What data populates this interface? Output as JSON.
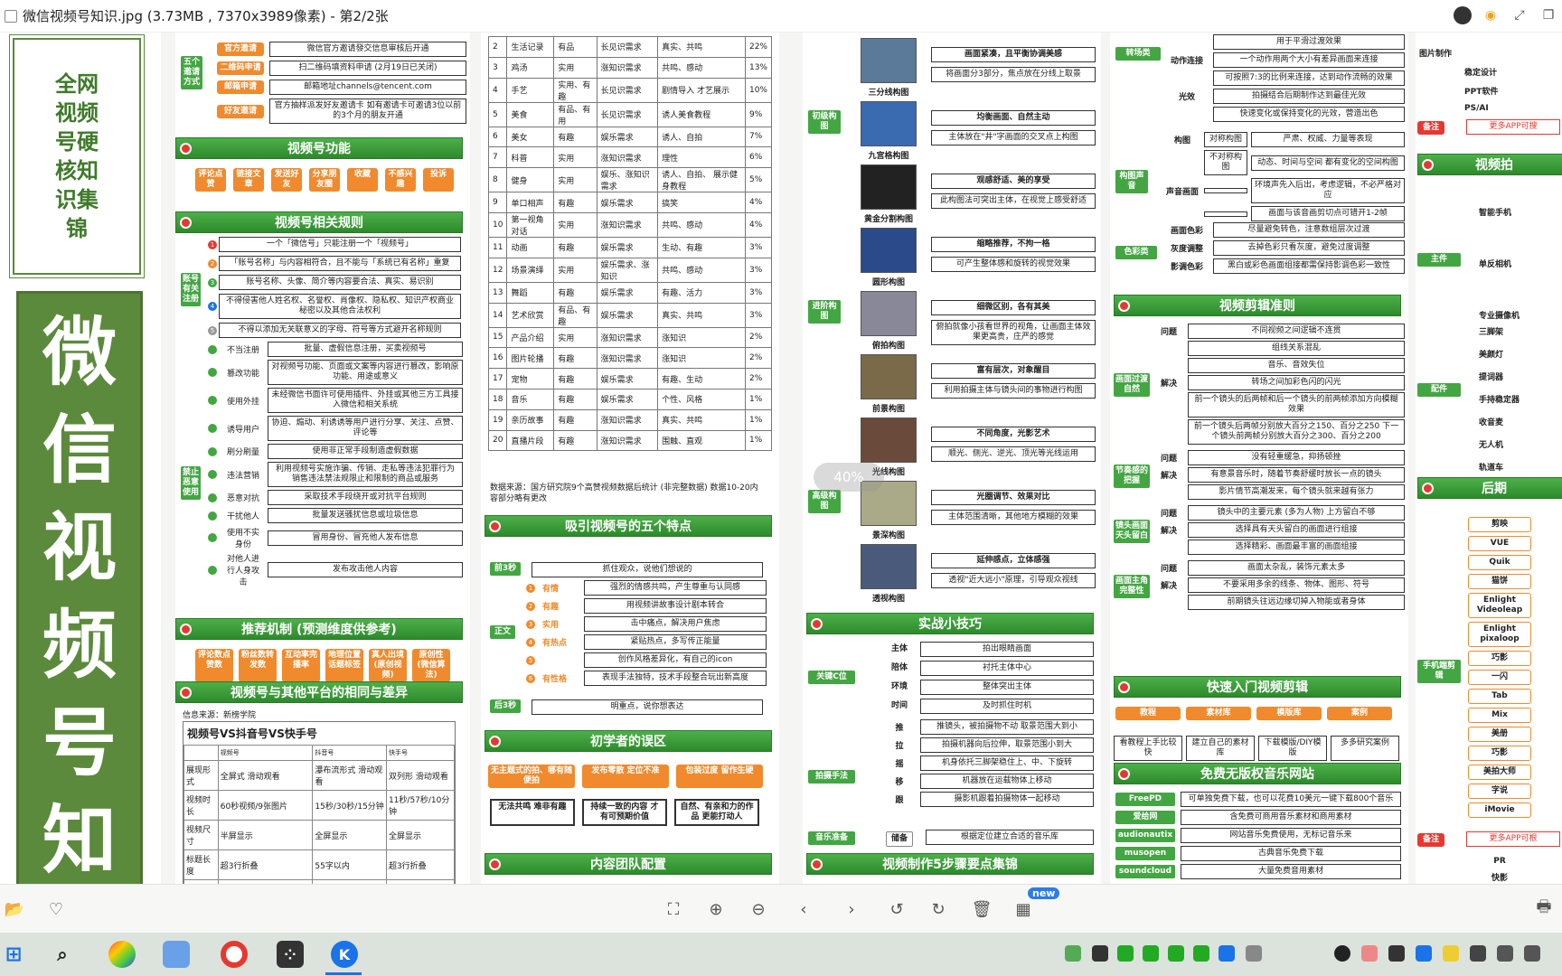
{
  "window": {
    "title": "微信视频号知识.jpg (3.73MB , 7370x3989像素) - 第2/2张"
  },
  "zoom": {
    "level": "40%"
  },
  "col1": {
    "card_title": "全网视频号硬核知识集锦",
    "big_title": "微信视频号知"
  },
  "col2": {
    "invite_label": "五个邀请方式",
    "invite_items": [
      {
        "tag": "官方邀请",
        "text": "微信官方邀请發交信息审核后开通"
      },
      {
        "tag": "二维码申请",
        "text": "扫二维码填资料申请 (2月19日已关闭)"
      },
      {
        "tag": "邮箱申请",
        "text": "邮箱地址channels@tencent.com"
      },
      {
        "tag": "好友邀请",
        "text": "官方抽样派发好友邀请卡 如有邀请卡可邀请3位以前的3个月的朋友开通"
      }
    ],
    "functions_title": "视频号功能",
    "functions": [
      "评论点赞",
      "链接文章",
      "发送好友",
      "分享朋友圈",
      "收藏",
      "不感兴趣",
      "投诉"
    ],
    "rules_title": "视频号相关规则",
    "account_label": "账号有关注册",
    "rules": [
      "一个「微信号」只能注册一个「视频号」",
      "「账号名称」与内容相符合，且不能与「系统已有名称」重复",
      "账号名称、头像、简介等内容要合法、真实、易识别",
      "不得侵害他人姓名权、名誉权、肖像权、隐私权、知识产权商业秘密以及其他合法权利",
      "不得以添加无关联意义的字母、符号等方式避开名称规则"
    ],
    "prohibit_label": "禁止恶意使用",
    "prohibits": [
      {
        "tag": "不当注册",
        "text": "批量、虚假信息注册，买卖视频号"
      },
      {
        "tag": "篡改功能",
        "text": "对视频号功能、页面或文案等内容进行篡改，影响原功能、用途或意义"
      },
      {
        "tag": "使用外挂",
        "text": "未经微信书面许可使用插件、外挂或其他三方工具接入微信和相关系统"
      },
      {
        "tag": "诱导用户",
        "text": "协迫、煽动、利诱诱等用户进行分享、关注、点赞、评论等"
      },
      {
        "tag": "刷分刷量",
        "text": "使用非正常手段制造虚假数据"
      },
      {
        "tag": "违法营销",
        "text": "利用视频号实施诈骗、传销、走私等违法犯罪行为 销售违法禁法规限止和限制的商品或服务"
      },
      {
        "tag": "恶意对抗",
        "text": "采取技术手段绕开或对抗平台规则"
      },
      {
        "tag": "干扰他人",
        "text": "批量发送骚扰信息或垃圾信息"
      },
      {
        "tag": "使用不实身份",
        "text": "冒用身份、冒充他人发布信息"
      },
      {
        "tag": "对他人进行人身攻击",
        "text": "发布攻击他人内容"
      }
    ],
    "recommend_title": "推荐机制 (预测维度供参考)",
    "recommend": [
      "评论数点赞数",
      "粉丝数转发数",
      "互动率完播率",
      "地理位置话题标签",
      "真人出境(原创视频)",
      "原创性(微信算法)"
    ],
    "compare_title": "视频号与其他平台的相同与差异",
    "compare_source": "信息来源：新榜学院",
    "vs_title": "视频号VS抖音号VS快手号",
    "vs_head": [
      "",
      "视频号",
      "抖音号",
      "快手号"
    ],
    "vs_rows": [
      [
        "展现形式",
        "全屏式 滑动观看",
        "瀑布流形式 滑动观看",
        "双列形 滑动观看"
      ],
      [
        "视频时长",
        "60秒视频/9张图片",
        "15秒/30秒/15分钟",
        "11秒/57秒/10分钟"
      ],
      [
        "视频尺寸",
        "半屏显示",
        "全屏显示",
        "全屏显示"
      ],
      [
        "标题长度",
        "超3行折叠",
        "55字以内",
        "超3行折叠"
      ],
      [
        "链接支持",
        "可加微信号 公众号文章链接",
        "不能加微信号",
        "不能加微信号"
      ]
    ]
  },
  "col3": {
    "rank_rows": [
      [
        "2",
        "生活记录",
        "有品",
        "长见识需求",
        "真实、共鸣",
        "22%"
      ],
      [
        "3",
        "鸡汤",
        "实用",
        "涨知识需求",
        "共鸣、感动",
        "13%"
      ],
      [
        "4",
        "手艺",
        "实用、有趣",
        "长见识需求",
        "剧情导入 才艺展示",
        "10%"
      ],
      [
        "5",
        "美食",
        "有品、有用",
        "长见识需求",
        "诱人美食教程",
        "9%"
      ],
      [
        "6",
        "美女",
        "有趣",
        "娱乐需求",
        "诱人、自拍",
        "7%"
      ],
      [
        "7",
        "科普",
        "实用",
        "涨知识需求",
        "理性",
        "6%"
      ],
      [
        "8",
        "健身",
        "实用",
        "娱乐、涨知识需求",
        "诱人、自拍、 展示健身教程",
        "5%"
      ],
      [
        "9",
        "单口相声",
        "有趣",
        "娱乐需求",
        "搞笑",
        "4%"
      ],
      [
        "10",
        "第一视角对话",
        "实用",
        "涨知识需求",
        "共鸣、感动",
        "4%"
      ],
      [
        "11",
        "动画",
        "有趣",
        "娱乐需求",
        "生动、有趣",
        "3%"
      ],
      [
        "12",
        "场景演绎",
        "实用",
        "娱乐需求、涨知识",
        "共鸣、感动",
        "3%"
      ],
      [
        "13",
        "舞蹈",
        "有趣",
        "娱乐需求",
        "有趣、活力",
        "3%"
      ],
      [
        "14",
        "艺术欣赏",
        "有品、有趣",
        "娱乐需求",
        "真实、共鸣",
        "3%"
      ],
      [
        "15",
        "产品介绍",
        "实用",
        "涨知识需求",
        "涨知识",
        "2%"
      ],
      [
        "16",
        "图片轮播",
        "有趣",
        "涨知识需求",
        "涨知识",
        "2%"
      ],
      [
        "17",
        "宠物",
        "有趣",
        "娱乐需求",
        "有趣、生动",
        "2%"
      ],
      [
        "18",
        "音乐",
        "有趣",
        "娱乐需求",
        "个性、风格",
        "1%"
      ],
      [
        "19",
        "亲历故事",
        "有趣",
        "涨知识需求",
        "真实、共鸣",
        "1%"
      ],
      [
        "20",
        "直播片段",
        "有趣",
        "涨知识需求",
        "围触、直观",
        "1%"
      ]
    ],
    "rank_source": "数据来源：国方研究院9个高赞视频数据后统计 (非完整数据) 数据10-20内容部分略有更改",
    "features_title": "吸引视频号的五个特点",
    "front_tag": "前3秒",
    "front_text": "抓住观众，说他们想说的",
    "body_tag": "正文",
    "features": [
      {
        "tag": "有情",
        "text": "强烈的情感共鸣，产生尊重与认同感"
      },
      {
        "tag": "有趣",
        "text": "用视频讲故事设计剧本转合"
      },
      {
        "tag": "实用",
        "text": "击中痛点，解决用户焦虑"
      },
      {
        "tag": "有热点",
        "text": "紧贴热点，多写传正能量"
      },
      {
        "tag": "",
        "text": "创作风格差异化，有自己的icon"
      },
      {
        "tag": "有性格",
        "text": "表现手法独特，技术手段整合玩出新高度"
      }
    ],
    "back_tag": "后3秒",
    "back_text": "明重点，说你想表达",
    "mistakes_title": "初学者的误区",
    "mistakes": [
      "无主题式的拍、哪有随便拍",
      "发布零散 定位不准",
      "包装过度 留作生硬"
    ],
    "mistake_fixes": [
      "无法共鸣 难非有趣",
      "持续一致的内容 才有可预期价值",
      "自然、有亲和力的作品 更能打动人"
    ],
    "team_title": "内容团队配置"
  },
  "col4": {
    "top_text": "画面紧凑，且平衡协调美感",
    "groups": [
      {
        "label": "初级构图",
        "items": [
          {
            "name": "三分线构图",
            "t1": "画面紧凑，且平衡协调美感",
            "t2": "将画面分3部分，焦点放在分线上取景"
          },
          {
            "name": "九宫格构图",
            "t1": "均衡画面、自然主动",
            "t2": "主体放在\"井\"字画面的交叉点上构图"
          },
          {
            "name": "黄金分割构图",
            "t1": "观感舒适、美的享受",
            "t2": "此构图法可突出主体，在视觉上感受舒适"
          }
        ]
      },
      {
        "label": "进阶构图",
        "items": [
          {
            "name": "圆形构图",
            "t1": "缩略推荐，不拘一格",
            "t2": "可产生整体感和旋转的视觉效果"
          },
          {
            "name": "俯拍构图",
            "t1": "细微区别，各有其美",
            "t2": "俯拍就像小孩看世界的视角，让画面主体效果更高贵，庄严的感觉"
          },
          {
            "name": "前景构图",
            "t1": "富有层次，对象醒目",
            "t2": "利用拍摄主体与镜头间的事物进行构图"
          }
        ]
      },
      {
        "label": "高级构图",
        "items": [
          {
            "name": "光线构图",
            "t1": "不同角度，光影艺术",
            "t2": "顺光、侧光、逆光、顶光等光线运用"
          },
          {
            "name": "景深构图",
            "t1": "光圈调节、效果对比",
            "t2": "主体范围清晰，其他地方模糊的效果"
          },
          {
            "name": "透视构图",
            "t1": "延伸感点，立体感强",
            "t2": "透视\"近大远小\"原理，引导观众视线"
          }
        ]
      }
    ],
    "tips_title": "实战小技巧",
    "focus_label": "关键C位",
    "focus": [
      {
        "tag": "主体",
        "text": "拍出眼睛画面"
      },
      {
        "tag": "陪体",
        "text": "衬托主体中心"
      },
      {
        "tag": "环境",
        "text": "整体突出主体"
      },
      {
        "tag": "时间",
        "text": "及时抓住时机"
      }
    ],
    "shoot_label": "拍摄手法",
    "shoot": [
      {
        "tag": "推",
        "text": "推镜头，被拍摄物不动 取景范围大到小"
      },
      {
        "tag": "拉",
        "text": "拍摄机器向后拉伸，取景范围小到大"
      },
      {
        "tag": "摇",
        "text": "机身依托三脚架稳住上、中、下旋转"
      },
      {
        "tag": "移",
        "text": "机器放在运载物体上移动"
      },
      {
        "tag": "跟",
        "text": "摄影机跟着拍摄物体一起移动"
      }
    ],
    "music_label": "音乐准备",
    "music_tag": "储备",
    "music_text": "根据定位建立合适的音乐库",
    "steps_title": "视频制作5步骤要点集锦"
  },
  "col5": {
    "top": [
      {
        "tag": "",
        "text": "用于平滑过渡效果"
      },
      {
        "tag": "动作连接",
        "text": "一个动作用两个大小有差异画面来连接"
      },
      {
        "tag": "",
        "text": "可按照7:3的比例来连接，达到动作流畅的效果"
      },
      {
        "tag": "光效",
        "text": "拍摄结合后期制作达到最佳光效"
      },
      {
        "tag": "",
        "text": "快速变化或保持变化的光效，营造出色"
      }
    ],
    "transition_label": "转场类",
    "composition_label": "构图声音",
    "comp_items": [
      {
        "tag": "构图",
        "sub": "对称构图",
        "text": "严肃、权威、力量等表现"
      },
      {
        "tag": "",
        "sub": "不对称构图",
        "text": "动态、时间与空间 都有变化的空间构图"
      },
      {
        "tag": "声音画面",
        "sub": "",
        "text": "环境声先入后出，考虑逻辑，不必严格对应"
      },
      {
        "tag": "",
        "sub": "",
        "text": "画面与该音画剪切点可错开1-2帧"
      }
    ],
    "color_label": "色彩类",
    "color_items": [
      {
        "tag": "画面色彩",
        "text": "尽量避免转色，注意数组层次过渡"
      },
      {
        "tag": "灰度调整",
        "text": "去掉色彩只看灰度，避免过度调整"
      },
      {
        "tag": "影调色彩",
        "text": "黑白或彩色画面组接都需保持影调色彩一致性"
      }
    ],
    "edit_title": "视频剪辑准则",
    "edit_groups": [
      {
        "label": "画面过渡自然",
        "items": [
          {
            "tag": "问题",
            "text": "不同视频之间逻辑不连贯"
          },
          {
            "tag": "",
            "text": "组线关系混乱"
          },
          {
            "tag": "",
            "text": "音乐、音效失位"
          },
          {
            "tag": "解决",
            "text": "转场之间加彩色闪的闪光"
          },
          {
            "tag": "",
            "text": "前一个镜头的后两帧和后一个镜头的前两帧添加方向模糊效果"
          },
          {
            "tag": "",
            "text": "前一个镜头后两帧分别放大百分之150、百分之250 下一个镜头前两帧分别放大百分之300、百分之200"
          }
        ]
      },
      {
        "label": "节奏感的把握",
        "items": [
          {
            "tag": "问题",
            "text": "没有轻重缓急，抑扬顿挫"
          },
          {
            "tag": "解决",
            "text": "有意景音乐时，随着节奏舒缓时放长一点的镜头"
          },
          {
            "tag": "",
            "text": "影片情节高潮发来，每个镜头就来越有张力"
          }
        ]
      },
      {
        "label": "镜头画面天头留白",
        "items": [
          {
            "tag": "问题",
            "text": "镜头中的主要元素 (多为人物) 上方留白不够"
          },
          {
            "tag": "解决",
            "text": "选择具有天头留白的画面进行组接"
          },
          {
            "tag": "",
            "text": "选择精彩、画面最丰富的画面组接"
          }
        ]
      },
      {
        "label": "画面主角完整性",
        "items": [
          {
            "tag": "问题",
            "text": "画面太杂乱，装饰元素太多"
          },
          {
            "tag": "解决",
            "text": "不要采用多余的线条、物体、图形、符号"
          },
          {
            "tag": "",
            "text": "前期镜头往远边缘切掉入物能或者身体"
          }
        ]
      }
    ],
    "quick_title": "快速入门视频剪辑",
    "quick": [
      "教程",
      "素材库",
      "模版库",
      "案例"
    ],
    "quick_sub": [
      "看教程上手比较快",
      "建立自己的素材库",
      "下载模版/DIY模版",
      "多多研究案例"
    ],
    "music_title": "免费无版权音乐网站",
    "music_sites": [
      {
        "tag": "FreePD",
        "text": "可单独免费下载，也可以花费10美元一键下载800个音乐"
      },
      {
        "tag": "爱给网",
        "text": "含免费可商用音乐素材和商用素材"
      },
      {
        "tag": "audionautix",
        "text": "网站音乐免费使用，无标记音乐来"
      },
      {
        "tag": "musopen",
        "text": "古典音乐免费下载"
      },
      {
        "tag": "soundcloud",
        "text": "大量免费音用素材"
      }
    ]
  },
  "col6": {
    "left_items": [
      "图片制作",
      "稳定设计",
      "PPT软件",
      "PS/AI"
    ],
    "note1": "备注",
    "note1_text": "更多APP可搜",
    "section2_title": "视频拍",
    "main_label": "主件",
    "main_items": [
      "智能手机",
      "单反相机",
      "专业摄像机"
    ],
    "sub_right": [
      "单",
      "安卓",
      "单",
      "无反",
      "专"
    ],
    "parts_label": "配件",
    "parts": [
      "三脚架",
      "美颜灯",
      "提词器",
      "手持稳定器",
      "收音麦",
      "无人机",
      "轨道车"
    ],
    "section3_title": "后期",
    "apps_label": "手机端剪辑",
    "apps": [
      "剪映",
      "VUE",
      "Quik",
      "猫饼",
      "Enlight Videoleap",
      "Enlight pixaloop",
      "巧影",
      "一闪",
      "Tab",
      "Mix",
      "美册",
      "巧影",
      "美拍大师",
      "字说",
      "iMovie"
    ],
    "note2": "备注",
    "note2_text": "更多APP可根",
    "bottom": [
      "PR",
      "快影"
    ]
  },
  "toolbar": {
    "new_badge": "new"
  },
  "colors": {
    "green": "#43a642",
    "dark_green": "#2d8a2b",
    "orange": "#f08a2c",
    "red": "#e53930",
    "olive": "#5c8a3c"
  }
}
